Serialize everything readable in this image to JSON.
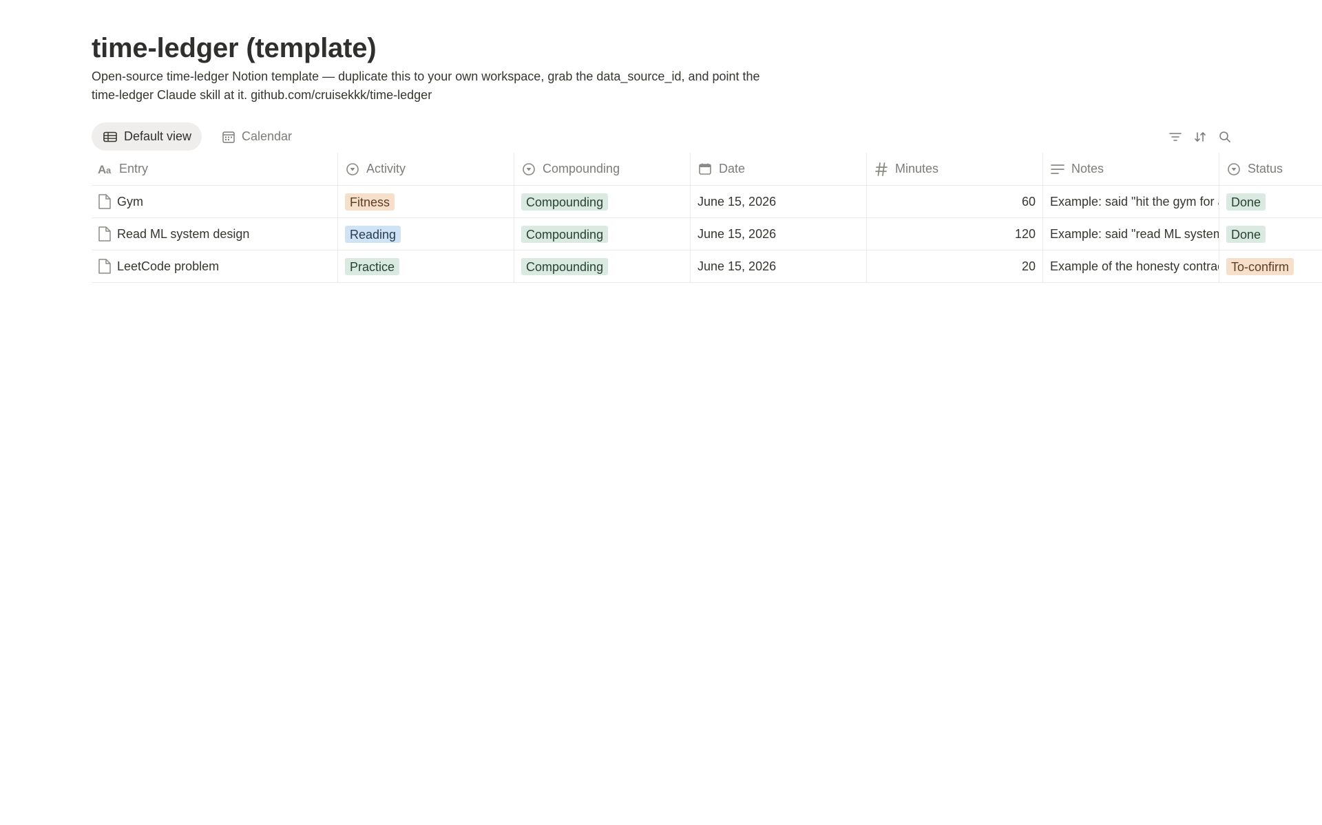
{
  "page": {
    "title": "time-ledger (template)",
    "description": "Open-source time-ledger Notion template — duplicate this to your own workspace, grab the data_source_id, and point the time-ledger Claude skill at it. github.com/cruisekkk/time-ledger"
  },
  "views": {
    "default_label": "Default view",
    "calendar_label": "Calendar",
    "default_icon": "table-icon",
    "calendar_icon": "calendar-icon",
    "active": "Default view"
  },
  "toolbar": {
    "filter_icon": "filter-icon",
    "sort_icon": "sort-icon",
    "search_icon": "search-icon"
  },
  "table": {
    "columns": [
      {
        "label": "Entry",
        "icon": "title-icon"
      },
      {
        "label": "Activity",
        "icon": "select-icon"
      },
      {
        "label": "Compounding",
        "icon": "select-icon"
      },
      {
        "label": "Date",
        "icon": "calendar-icon"
      },
      {
        "label": "Minutes",
        "icon": "number-icon"
      },
      {
        "label": "Notes",
        "icon": "text-icon"
      },
      {
        "label": "Status",
        "icon": "select-icon"
      }
    ],
    "rows": [
      {
        "entry": "Gym",
        "activity": "Fitness",
        "compounding": "Compounding",
        "date": "June 15, 2026",
        "minutes": "60",
        "notes": "Example: said \"hit the gym for a",
        "status": "Done"
      },
      {
        "entry": "Read ML system design",
        "activity": "Reading",
        "compounding": "Compounding",
        "date": "June 15, 2026",
        "minutes": "120",
        "notes": "Example: said \"read ML system",
        "status": "Done"
      },
      {
        "entry": "LeetCode problem",
        "activity": "Practice",
        "compounding": "Compounding",
        "date": "June 15, 2026",
        "minutes": "20",
        "notes": "Example of the honesty contrac",
        "status": "To-confirm"
      }
    ]
  },
  "colors": {
    "tag_orange_bg": "#f6dfcb",
    "tag_blue_bg": "#cfe3f5",
    "tag_green_bg": "#dae9e1",
    "active_view_bg": "#efeeec"
  }
}
